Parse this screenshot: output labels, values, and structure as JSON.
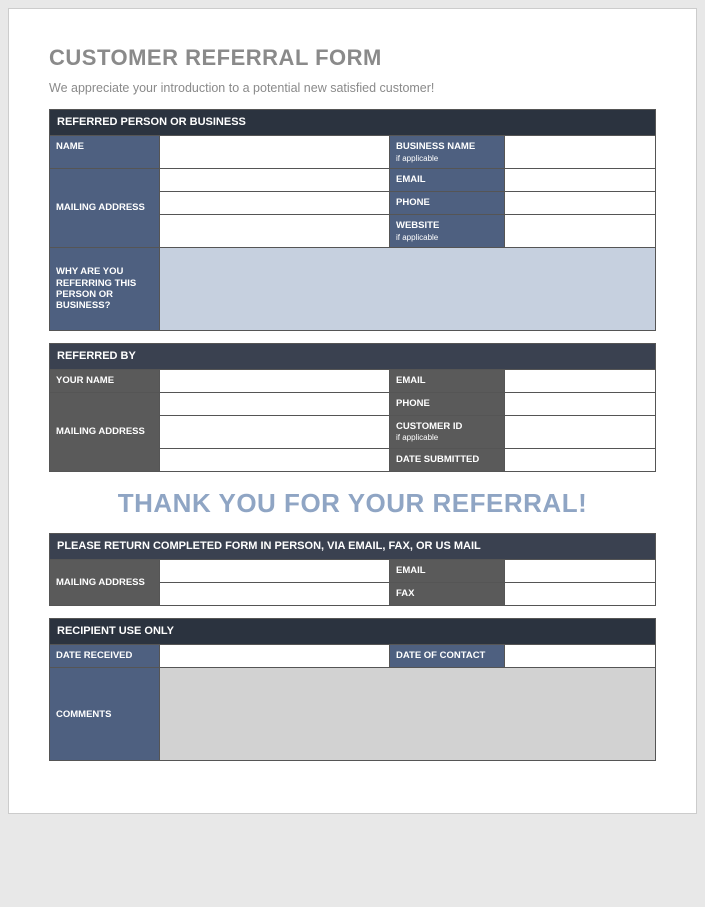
{
  "title": "CUSTOMER REFERRAL FORM",
  "subtitle": "We appreciate your introduction to a potential new satisfied customer!",
  "thankyou": "THANK YOU FOR YOUR REFERRAL!",
  "s1": {
    "header": "REFERRED PERSON OR BUSINESS",
    "name_lbl": "NAME",
    "mailing_lbl": "MAILING ADDRESS",
    "reason_lbl": "WHY ARE YOU REFERRING THIS PERSON OR BUSINESS?",
    "biz_lbl": "BUSINESS NAME",
    "biz_sub": "if applicable",
    "email_lbl": "EMAIL",
    "phone_lbl": "PHONE",
    "web_lbl": "WEBSITE",
    "web_sub": "if applicable",
    "name": "",
    "mailing1": "",
    "mailing2": "",
    "mailing3": "",
    "biz": "",
    "email": "",
    "phone": "",
    "web": "",
    "reason": ""
  },
  "s2": {
    "header": "REFERRED BY",
    "name_lbl": "YOUR NAME",
    "mailing_lbl": "MAILING ADDRESS",
    "email_lbl": "EMAIL",
    "phone_lbl": "PHONE",
    "cust_lbl": "CUSTOMER ID",
    "cust_sub": "if applicable",
    "date_lbl": "DATE SUBMITTED",
    "name": "",
    "mailing1": "",
    "mailing2": "",
    "mailing3": "",
    "mailing4": "",
    "email": "",
    "phone": "",
    "cust": "",
    "date": ""
  },
  "s3": {
    "header": "PLEASE RETURN COMPLETED FORM IN PERSON, VIA EMAIL, FAX, OR US MAIL",
    "mailing_lbl": "MAILING ADDRESS",
    "email_lbl": "EMAIL",
    "fax_lbl": "FAX",
    "mailing1": "",
    "mailing2": "",
    "email": "",
    "fax": ""
  },
  "s4": {
    "header": "RECIPIENT USE ONLY",
    "recv_lbl": "DATE RECEIVED",
    "contact_lbl": "DATE OF CONTACT",
    "comments_lbl": "COMMENTS",
    "recv": "",
    "contact": "",
    "comments": ""
  }
}
